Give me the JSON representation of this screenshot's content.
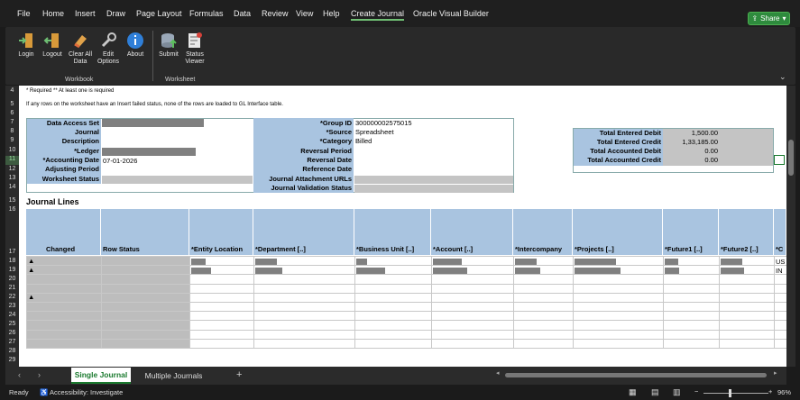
{
  "menu": {
    "items": [
      "File",
      "Home",
      "Insert",
      "Draw",
      "Page Layout",
      "Formulas",
      "Data",
      "Review",
      "View",
      "Help",
      "Create Journal",
      "Oracle Visual Builder"
    ],
    "active": "Create Journal",
    "share_label": "Share"
  },
  "ribbon": {
    "workbook_buttons": [
      {
        "label": "Login",
        "icon": "login-icon"
      },
      {
        "label": "Logout",
        "icon": "logout-icon"
      },
      {
        "label": "Clear All Data",
        "icon": "eraser-icon"
      },
      {
        "label": "Edit Options",
        "icon": "wrench-icon"
      },
      {
        "label": "About",
        "icon": "info-icon"
      }
    ],
    "worksheet_buttons": [
      {
        "label": "Submit",
        "icon": "database-upload-icon"
      },
      {
        "label": "Status Viewer",
        "icon": "status-viewer-icon"
      }
    ],
    "workbook_group": "Workbook",
    "worksheet_group": "Worksheet"
  },
  "sheet": {
    "note1": "* Required  ** At least one is required",
    "note2": "If any rows on the worksheet have an Insert failed status, none of the rows are loaded to GL Interface table.",
    "header_left_labels": [
      "Data Access Set",
      "Journal",
      "Description",
      "*Ledger",
      "*Accounting Date",
      "Adjusting Period",
      "Worksheet Status"
    ],
    "accounting_date": "07-01-2026",
    "header_mid_labels": [
      "*Group ID",
      "*Source",
      "*Category",
      "Reversal Period",
      "Reversal Date",
      "Reference Date",
      "Journal Attachment URLs",
      "Journal Validation Status"
    ],
    "group_id": "300000002575015",
    "source": "Spreadsheet",
    "category": "Billed",
    "totals": [
      {
        "label": "Total Entered Debit",
        "value": "1,500.00"
      },
      {
        "label": "Total Entered Credit",
        "value": "1,33,185.00"
      },
      {
        "label": "Total Accounted Debit",
        "value": "0.00"
      },
      {
        "label": "Total Accounted Credit",
        "value": "0.00"
      }
    ],
    "journal_lines_title": "Journal Lines",
    "columns": [
      "Changed",
      "Row Status",
      "*Entity Location",
      "*Department [..]",
      "*Business Unit [..]",
      "*Account [..]",
      "*Intercompany",
      "*Projects [..]",
      "*Future1 [..]",
      "*Future2 [..]",
      "*C"
    ],
    "last_col_values": [
      "US",
      "IN"
    ],
    "row_numbers": [
      "4",
      "5",
      "6",
      "7",
      "8",
      "9",
      "10",
      "11",
      "12",
      "13",
      "14",
      "15",
      "16",
      "17",
      "18",
      "19",
      "20",
      "21",
      "22",
      "23",
      "24",
      "25",
      "26",
      "27",
      "28",
      "29"
    ],
    "changed_marker": "▲"
  },
  "tabs": {
    "items": [
      "Single Journal",
      "Multiple Journals"
    ],
    "add": "+"
  },
  "status": {
    "ready": "Ready",
    "accessibility": "Accessibility: Investigate",
    "zoom": "96%",
    "minus": "−",
    "plus": "+"
  }
}
